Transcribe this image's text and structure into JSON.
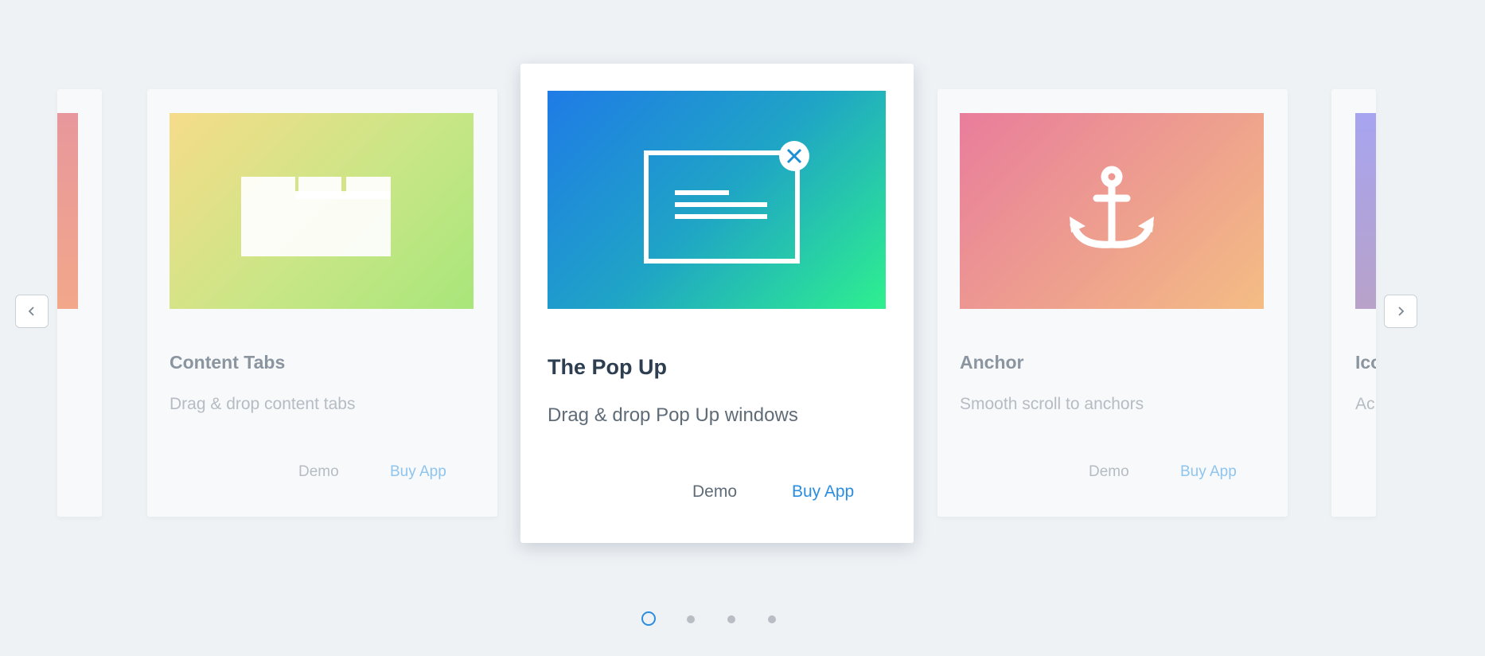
{
  "carousel": {
    "cards": [
      {
        "title": "Content Tabs",
        "description": "Drag & drop content tabs",
        "demo_label": "Demo",
        "buy_label": "Buy App",
        "icon": "content-tabs-icon",
        "gradient": [
          "#f6dc8a",
          "#a8e67a"
        ]
      },
      {
        "title": "The Pop Up",
        "description": "Drag & drop Pop Up windows",
        "demo_label": "Demo",
        "buy_label": "Buy App",
        "icon": "popup-window-icon",
        "gradient": [
          "#1f7be6",
          "#2ef08e"
        ]
      },
      {
        "title": "Anchor",
        "description": "Smooth scroll to anchors",
        "demo_label": "Demo",
        "buy_label": "Buy App",
        "icon": "anchor-icon",
        "gradient": [
          "#e97d9c",
          "#f4bd84"
        ]
      }
    ],
    "partial_right": {
      "title": "Ico",
      "description": "Ac",
      "gradient": [
        "#a7a4f0",
        "#b8a2c9"
      ]
    },
    "partial_left": {
      "gradient": [
        "#e8979c",
        "#f2a78a"
      ]
    },
    "prev_icon": "chevron-left-icon",
    "next_icon": "chevron-right-icon",
    "pagination": {
      "count": 4,
      "active_index": 0
    },
    "colors": {
      "accent": "#2b8de0",
      "background": "#eff2f5"
    }
  }
}
